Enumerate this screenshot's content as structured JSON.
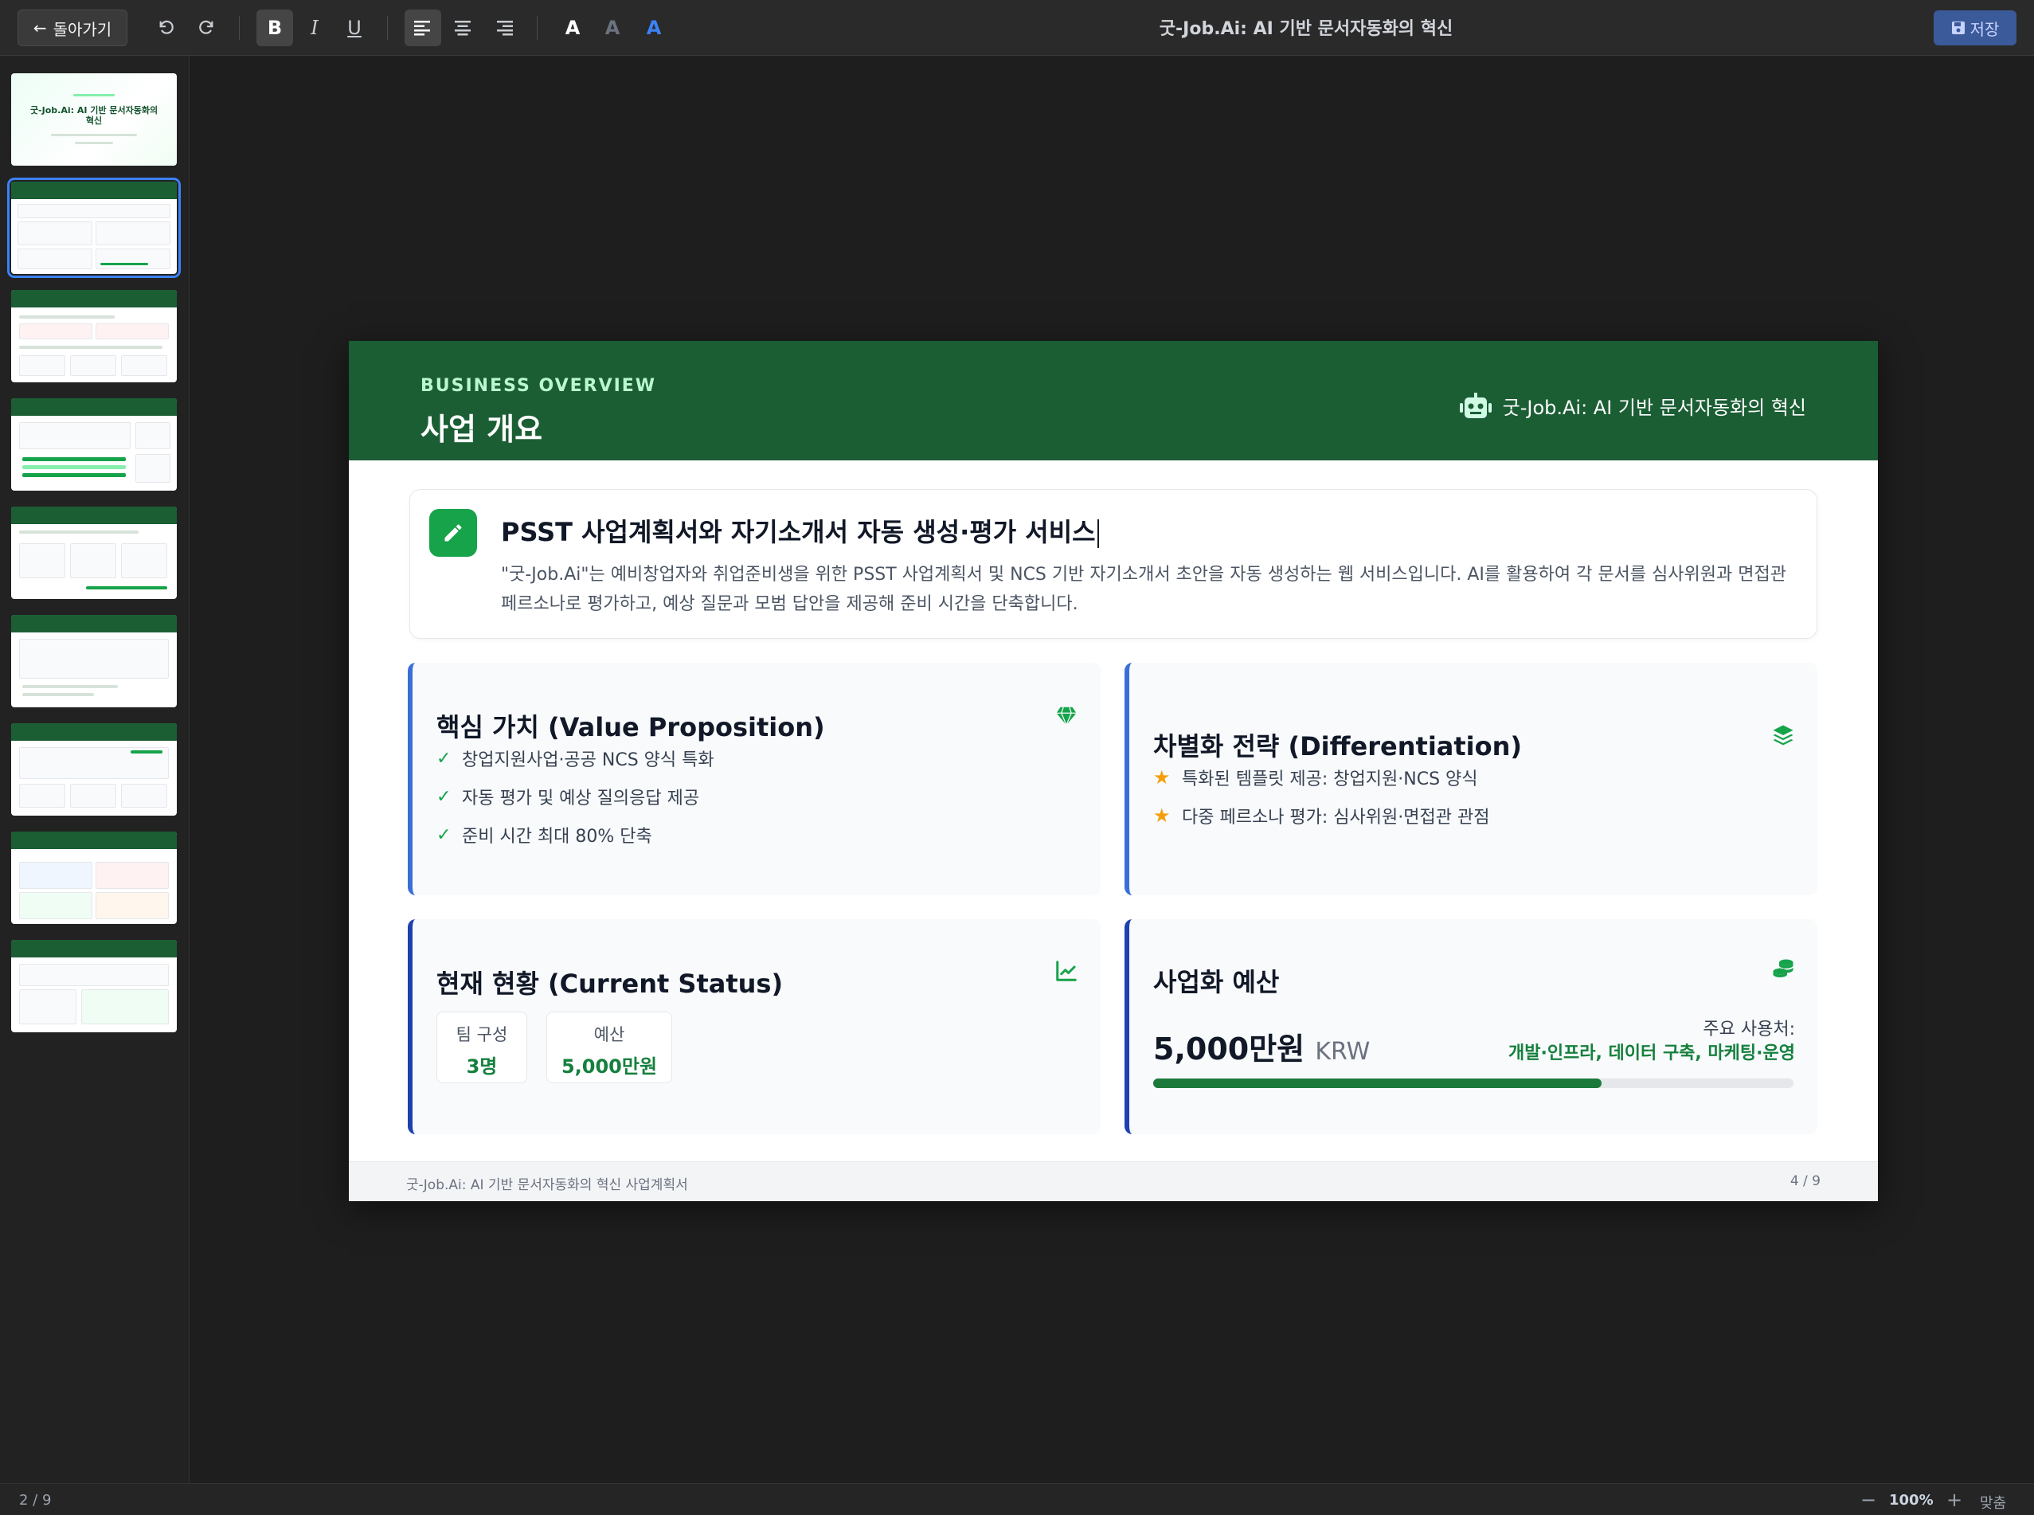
{
  "toolbar": {
    "back_label": "돌아가기",
    "doc_title": "굿-Job.Ai: AI 기반 문서자동화의 혁신",
    "save_label": "저장",
    "bold_glyph": "B",
    "italic_glyph": "I",
    "underline_glyph": "U",
    "text_color_glyph": "A"
  },
  "sidebar": {
    "cover_title": "굿-Job.Ai: AI 기반 문서자동화의 혁신",
    "slide_count": 9,
    "active_index": 1
  },
  "status": {
    "page_indicator": "2 / 9",
    "zoom": "100%",
    "zoom_minus": "−",
    "zoom_plus": "+",
    "fit_label": "맞춤"
  },
  "slide": {
    "eyebrow": "BUSINESS OVERVIEW",
    "title": "사업 개요",
    "brand": "굿-Job.Ai: AI 기반 문서자동화의 혁신",
    "intro": {
      "title": "PSST 사업계획서와 자기소개서 자동 생성·평가 서비스",
      "desc": "\"굿-Job.Ai\"는 예비창업자와 취업준비생을 위한 PSST 사업계획서 및 NCS 기반 자기소개서 초안을 자동 생성하는 웹 서비스입니다. AI를 활용하여 각 문서를 심사위원과 면접관 페르소나로 평가하고, 예상 질문과 모범 답안을 제공해 준비 시간을 단축합니다."
    },
    "value_prop": {
      "title": "핵심 가치 (Value Proposition)",
      "items": [
        "창업지원사업·공공 NCS 양식 특화",
        "자동 평가 및 예상 질의응답 제공",
        "준비 시간 최대 80% 단축"
      ]
    },
    "differentiation": {
      "title": "차별화 전략 (Differentiation)",
      "items": [
        "특화된 템플릿 제공: 창업지원·NCS 양식",
        "다중 페르소나 평가: 심사위원·면접관 관점"
      ]
    },
    "status": {
      "title": "현재 현황 (Current Status)",
      "team_label": "팀 구성",
      "team_value": "3명",
      "budget_label": "예산",
      "budget_value": "5,000만원"
    },
    "budget": {
      "title": "사업화 예산",
      "amount": "5,000만원",
      "unit": "KRW",
      "usage_label": "주요 사용처:",
      "usage_value": "개발·인프라, 데이터 구축, 마케팅·운영",
      "progress_fraction": 0.7
    },
    "footer_left": "굿-Job.Ai: AI 기반 문서자동화의 혁신 사업계획서",
    "footer_right": "4 / 9"
  },
  "colors": {
    "header_green": "#1b5e34",
    "accent_green": "#16a34a",
    "card_border_blue": "#3b6fd8",
    "save_blue": "#3b5a9a"
  }
}
